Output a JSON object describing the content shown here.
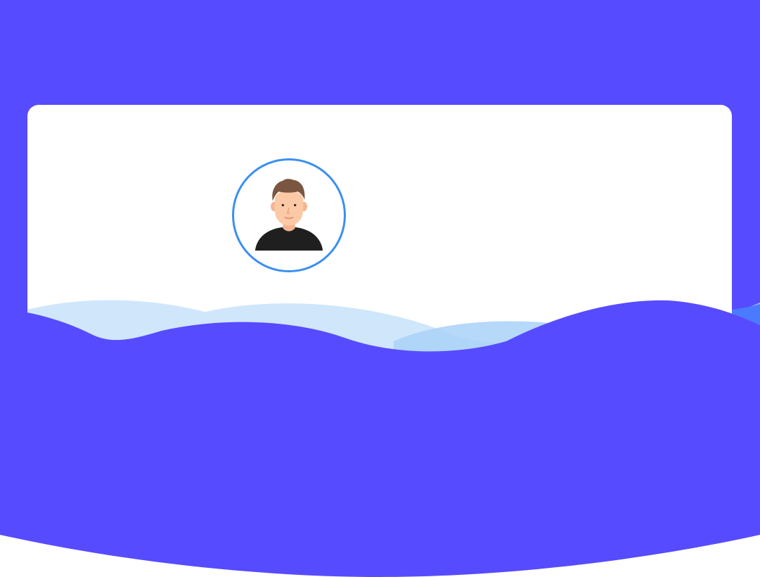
{
  "profile": {
    "avatar": {
      "icon": "user-avatar-icon",
      "description_role": "profile picture"
    }
  },
  "colors": {
    "brand": "#574bff",
    "wave_light": "#cfe6fb",
    "wave_mid": "#a9d1f8",
    "avatar_ring": "#3c8ff0",
    "card": "#ffffff"
  }
}
